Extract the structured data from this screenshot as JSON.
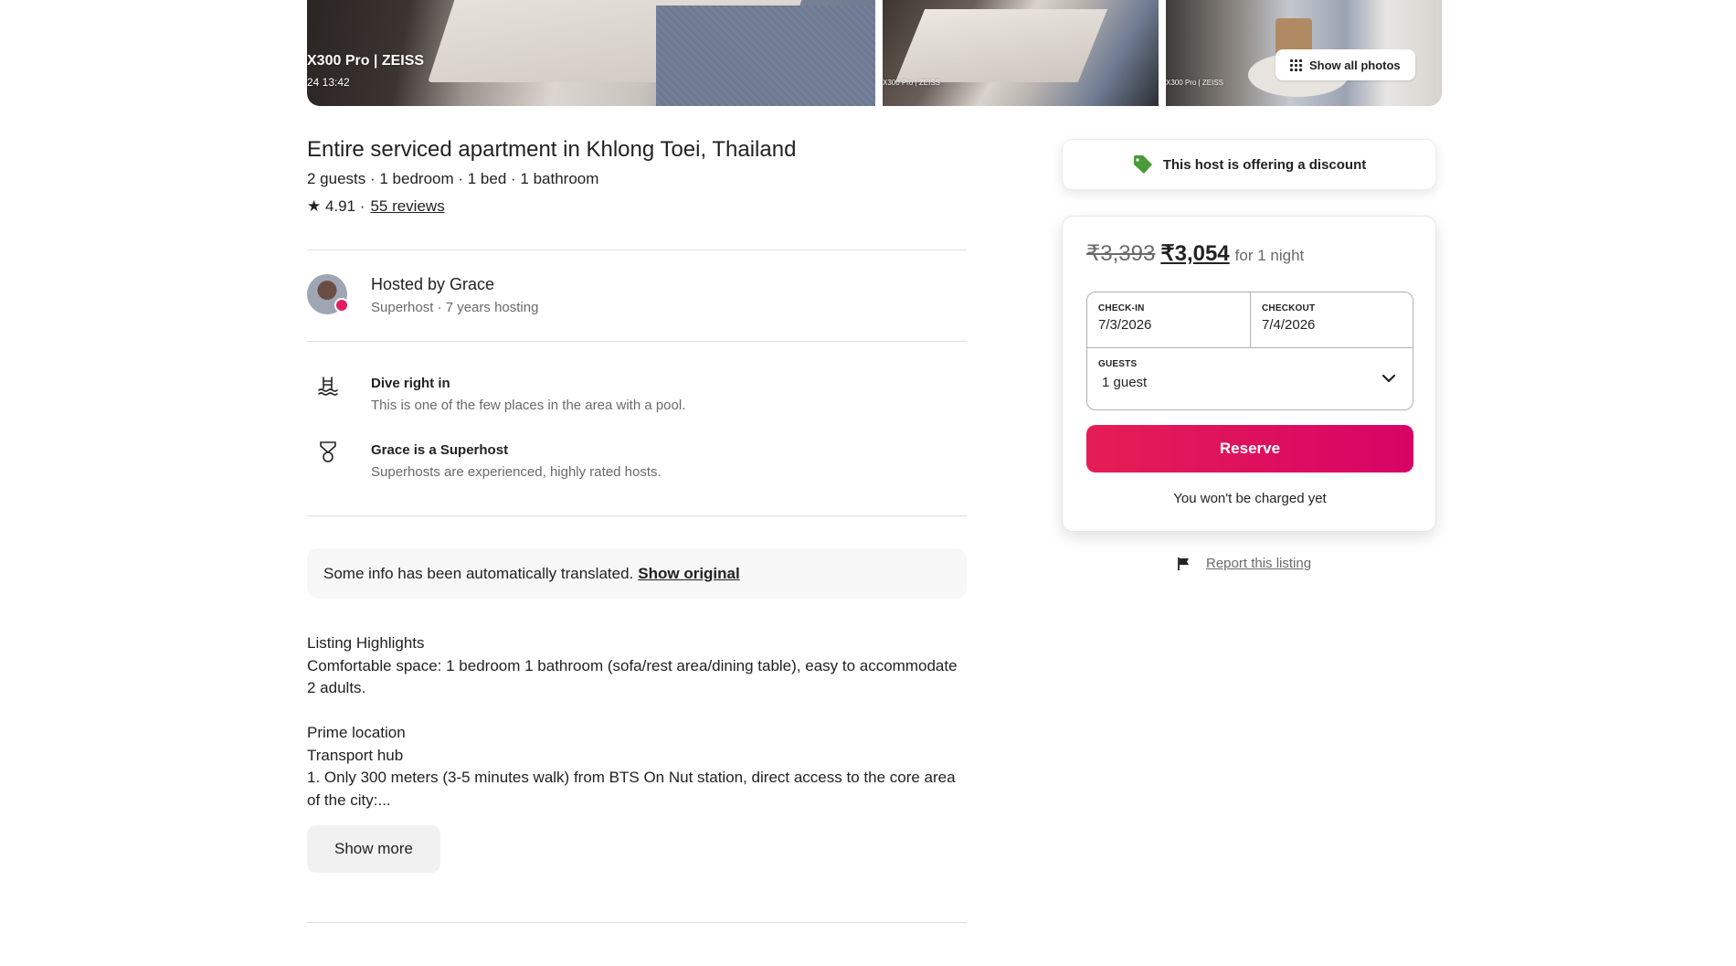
{
  "photos": {
    "watermark_main": "X300 Pro | ZEISS",
    "timestamp_main": "24 13:42",
    "watermark_small": "X300 Pro | ZEISS",
    "show_all_label": "Show all photos"
  },
  "listing": {
    "title": "Entire serviced apartment in Khlong Toei, Thailand",
    "specs": "2 guests · 1 bedroom · 1 bed · 1 bathroom",
    "rating": "★ 4.91 ·",
    "reviews_link": "55 reviews"
  },
  "host": {
    "name": "Hosted by Grace",
    "subtitle": "Superhost · 7 years hosting"
  },
  "highlights": [
    {
      "icon": "pool-icon",
      "title": "Dive right in",
      "desc": "This is one of the few places in the area with a pool."
    },
    {
      "icon": "superhost-medal-icon",
      "title": "Grace is a Superhost",
      "desc": "Superhosts are experienced, highly rated hosts."
    }
  ],
  "translation": {
    "text": "Some info has been automatically translated.",
    "link": "Show original"
  },
  "description": {
    "lines_1": [
      "Listing Highlights",
      "Comfortable space: 1 bedroom 1 bathroom (sofa/rest area/dining table), easy to accommodate 2 adults."
    ],
    "lines_2": [
      "Prime location",
      "Transport hub",
      "1. Only 300 meters (3-5 minutes walk) from BTS On Nut station, direct access to the core area of the city:..."
    ],
    "show_more": "Show more"
  },
  "discount_banner": {
    "text": "This host is offering a discount",
    "icon": "price-tag-icon",
    "icon_color": "#4a9a3a"
  },
  "booking": {
    "old_price": "₹3,393",
    "new_price": "₹3,054",
    "per": "for 1 night",
    "checkin_label": "CHECK-IN",
    "checkin_value": "7/3/2026",
    "checkout_label": "CHECKOUT",
    "checkout_value": "7/4/2026",
    "guests_label": "GUESTS",
    "guests_value": "1 guest",
    "reserve_label": "Reserve",
    "reserve_color": "#e31c5f",
    "note": "You won't be charged yet"
  },
  "report": {
    "label": "Report this listing",
    "icon": "flag-icon"
  }
}
